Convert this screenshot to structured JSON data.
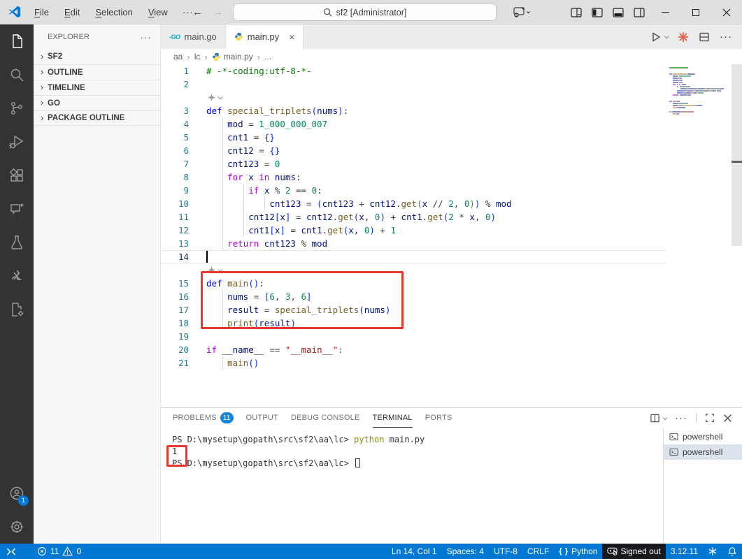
{
  "titlebar": {
    "menus": [
      "File",
      "Edit",
      "Selection",
      "View"
    ],
    "more_label": "···",
    "search": "sf2 [Administrator]"
  },
  "activitybar": {
    "icons": [
      "explorer",
      "search",
      "source-control",
      "run-and-debug",
      "extensions",
      "copilot-chat",
      "testing",
      "extension-swirl",
      "file-settings",
      "account",
      "settings-gear"
    ],
    "account_badge": "1"
  },
  "sidebar": {
    "title": "EXPLORER",
    "sections": [
      {
        "label": "SF2"
      },
      {
        "label": "OUTLINE"
      },
      {
        "label": "TIMELINE"
      },
      {
        "label": "GO"
      },
      {
        "label": "PACKAGE OUTLINE"
      }
    ]
  },
  "tabs": [
    {
      "label": "main.go",
      "icon": "go",
      "icon_text": "-GO",
      "active": false
    },
    {
      "label": "main.py",
      "icon": "python",
      "active": true,
      "closable": true
    }
  ],
  "breadcrumb": [
    {
      "label": "aa"
    },
    {
      "label": "lc"
    },
    {
      "label": "main.py",
      "icon": "python"
    },
    {
      "label": "..."
    }
  ],
  "editor": {
    "lines": [
      {
        "n": 1,
        "t": [
          [
            "# -*-coding:utf-8-*-",
            "com"
          ]
        ]
      },
      {
        "n": 2,
        "t": []
      },
      {
        "lens": true
      },
      {
        "n": 3,
        "t": [
          [
            "def",
            "kw"
          ],
          [
            " "
          ],
          [
            "special_triplets",
            "fn"
          ],
          [
            "(",
            "p1"
          ],
          [
            "nums",
            "var"
          ],
          [
            ")",
            "p1"
          ],
          [
            ":"
          ]
        ]
      },
      {
        "n": 4,
        "g": 1,
        "t": [
          [
            "    "
          ],
          [
            "mod",
            "var"
          ],
          [
            " = "
          ],
          [
            "1_000_000_007",
            "num"
          ]
        ]
      },
      {
        "n": 5,
        "g": 1,
        "t": [
          [
            "    "
          ],
          [
            "cnt1",
            "var"
          ],
          [
            " = "
          ],
          [
            "{}",
            "p1"
          ]
        ]
      },
      {
        "n": 6,
        "g": 1,
        "t": [
          [
            "    "
          ],
          [
            "cnt12",
            "var"
          ],
          [
            " = "
          ],
          [
            "{}",
            "p1"
          ]
        ]
      },
      {
        "n": 7,
        "g": 1,
        "t": [
          [
            "    "
          ],
          [
            "cnt123",
            "var"
          ],
          [
            " = "
          ],
          [
            "0",
            "num"
          ]
        ]
      },
      {
        "n": 8,
        "g": 1,
        "t": [
          [
            "    "
          ],
          [
            "for",
            "ctl"
          ],
          [
            " "
          ],
          [
            "x",
            "var"
          ],
          [
            " "
          ],
          [
            "in",
            "ctl"
          ],
          [
            " "
          ],
          [
            "nums",
            "var"
          ],
          [
            ":"
          ]
        ]
      },
      {
        "n": 9,
        "g": 2,
        "t": [
          [
            "        "
          ],
          [
            "if",
            "ctl"
          ],
          [
            " "
          ],
          [
            "x",
            "var"
          ],
          [
            " % "
          ],
          [
            "2",
            "num"
          ],
          [
            " == "
          ],
          [
            "0",
            "num"
          ],
          [
            ":"
          ]
        ]
      },
      {
        "n": 10,
        "g": 3,
        "t": [
          [
            "            "
          ],
          [
            "cnt123",
            "var"
          ],
          [
            " = "
          ],
          [
            "(",
            "p1"
          ],
          [
            "cnt123",
            "var"
          ],
          [
            " + "
          ],
          [
            "cnt12",
            "var"
          ],
          [
            "."
          ],
          [
            "get",
            "fn"
          ],
          [
            "(",
            "p2"
          ],
          [
            "x",
            "var"
          ],
          [
            " // "
          ],
          [
            "2",
            "num"
          ],
          [
            ", "
          ],
          [
            "0",
            "num"
          ],
          [
            ")",
            "p2"
          ],
          [
            ")",
            "p1"
          ],
          [
            " % "
          ],
          [
            "mod",
            "var"
          ]
        ]
      },
      {
        "n": 11,
        "g": 2,
        "t": [
          [
            "        "
          ],
          [
            "cnt12",
            "var"
          ],
          [
            "[",
            "p1"
          ],
          [
            "x",
            "var"
          ],
          [
            "]",
            "p1"
          ],
          [
            " = "
          ],
          [
            "cnt12",
            "var"
          ],
          [
            "."
          ],
          [
            "get",
            "fn"
          ],
          [
            "(",
            "p1"
          ],
          [
            "x",
            "var"
          ],
          [
            ", "
          ],
          [
            "0",
            "num"
          ],
          [
            ")",
            "p1"
          ],
          [
            " + "
          ],
          [
            "cnt1",
            "var"
          ],
          [
            "."
          ],
          [
            "get",
            "fn"
          ],
          [
            "(",
            "p1"
          ],
          [
            "2",
            "num"
          ],
          [
            " * "
          ],
          [
            "x",
            "var"
          ],
          [
            ", "
          ],
          [
            "0",
            "num"
          ],
          [
            ")",
            "p1"
          ]
        ]
      },
      {
        "n": 12,
        "g": 2,
        "t": [
          [
            "        "
          ],
          [
            "cnt1",
            "var"
          ],
          [
            "[",
            "p1"
          ],
          [
            "x",
            "var"
          ],
          [
            "]",
            "p1"
          ],
          [
            " = "
          ],
          [
            "cnt1",
            "var"
          ],
          [
            "."
          ],
          [
            "get",
            "fn"
          ],
          [
            "(",
            "p1"
          ],
          [
            "x",
            "var"
          ],
          [
            ", "
          ],
          [
            "0",
            "num"
          ],
          [
            ")",
            "p1"
          ],
          [
            " + "
          ],
          [
            "1",
            "num"
          ]
        ]
      },
      {
        "n": 13,
        "g": 1,
        "t": [
          [
            "    "
          ],
          [
            "return",
            "ctl"
          ],
          [
            " "
          ],
          [
            "cnt123",
            "var"
          ],
          [
            " % "
          ],
          [
            "mod",
            "var"
          ]
        ]
      },
      {
        "n": 14,
        "t": [],
        "cursor": true,
        "cur": true
      },
      {
        "lens": true
      },
      {
        "n": 15,
        "t": [
          [
            "def",
            "kw"
          ],
          [
            " "
          ],
          [
            "main",
            "fn"
          ],
          [
            "(",
            "p1"
          ],
          [
            ")",
            "p1"
          ],
          [
            ":"
          ]
        ]
      },
      {
        "n": 16,
        "g": 1,
        "t": [
          [
            "    "
          ],
          [
            "nums",
            "var"
          ],
          [
            " = "
          ],
          [
            "[",
            "p1"
          ],
          [
            "6",
            "num"
          ],
          [
            ", "
          ],
          [
            "3",
            "num"
          ],
          [
            ", "
          ],
          [
            "6",
            "num"
          ],
          [
            "]",
            "p1"
          ]
        ]
      },
      {
        "n": 17,
        "g": 1,
        "t": [
          [
            "    "
          ],
          [
            "result",
            "var"
          ],
          [
            " = "
          ],
          [
            "special_triplets",
            "fn"
          ],
          [
            "(",
            "p1"
          ],
          [
            "nums",
            "var"
          ],
          [
            ")",
            "p1"
          ]
        ]
      },
      {
        "n": 18,
        "g": 1,
        "t": [
          [
            "    "
          ],
          [
            "print",
            "fn"
          ],
          [
            "(",
            "p1"
          ],
          [
            "result",
            "var"
          ],
          [
            ")",
            "p1"
          ]
        ]
      },
      {
        "n": 19,
        "t": []
      },
      {
        "n": 20,
        "t": [
          [
            "if",
            "ctl"
          ],
          [
            " "
          ],
          [
            "__name__",
            "var"
          ],
          [
            " == "
          ],
          [
            "\"__main__\"",
            "str"
          ],
          [
            ":"
          ]
        ]
      },
      {
        "n": 21,
        "g": 1,
        "t": [
          [
            "    "
          ],
          [
            "main",
            "fn"
          ],
          [
            "(",
            "p1"
          ],
          [
            ")",
            "p1"
          ]
        ]
      }
    ]
  },
  "panel": {
    "tabs": [
      {
        "label": "PROBLEMS",
        "badge": "11"
      },
      {
        "label": "OUTPUT"
      },
      {
        "label": "DEBUG CONSOLE"
      },
      {
        "label": "TERMINAL",
        "active": true
      },
      {
        "label": "PORTS"
      }
    ],
    "terminal_lines": [
      {
        "parts": [
          [
            "PS D:\\mysetup\\gopath\\src\\sf2\\aa\\lc> "
          ],
          [
            "python",
            "cmd"
          ],
          [
            " main.py"
          ]
        ]
      },
      {
        "parts": [
          [
            "1"
          ]
        ]
      },
      {
        "parts": [
          [
            "PS D:\\mysetup\\gopath\\src\\sf2\\aa\\lc> "
          ]
        ],
        "cursor": true
      }
    ],
    "terminal_list": [
      "powershell",
      "powershell"
    ],
    "terminal_list_selected": 1
  },
  "statusbar": {
    "errors": "11",
    "warnings": "0",
    "line_col": "Ln 14, Col 1",
    "spaces": "Spaces: 4",
    "encoding": "UTF-8",
    "eol": "CRLF",
    "language": "Python",
    "signin": "Signed out",
    "version": "3.12.11"
  },
  "colors": {
    "accent": "#0078d4",
    "annotation_red": "#e8392e",
    "problems_badge": "#1a85d2",
    "terminal_command": "#8f9300",
    "go_brand": "#00acd7"
  }
}
